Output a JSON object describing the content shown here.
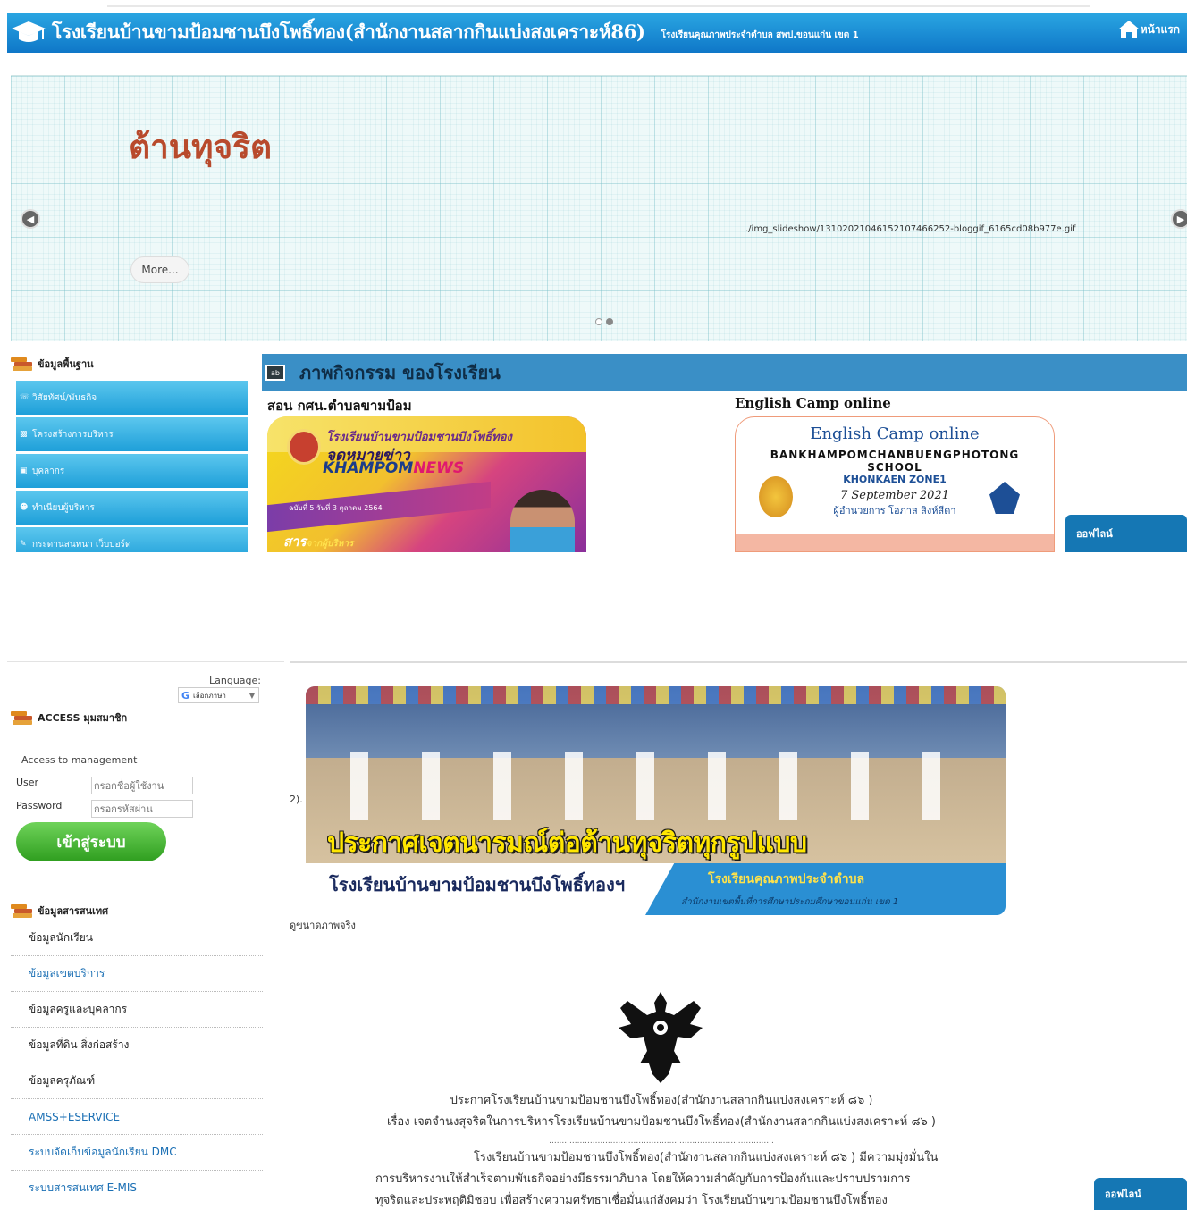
{
  "header": {
    "title": "โรงเรียนบ้านขามป้อมชานบึงโพธิ์ทอง(สำนักงานสลากกินแบ่งสงเคราะห์86)",
    "subtitle": "โรงเรียนคุณภาพประจำตำบล สพป.ขอนแก่น เขต 1",
    "home_label": "หน้าแรก"
  },
  "slideshow": {
    "heading": "ต้านทุจริต",
    "caption": "./img_slideshow/131020210461521074662​52-bloggif_6165cd08b977e.gif",
    "more_label": "More..."
  },
  "basic_info": {
    "heading": "ข้อมูลพื้นฐาน",
    "items": [
      {
        "label": "วิสัยทัศน์/พันธกิจ"
      },
      {
        "label": "โครงสร้างการบริหาร"
      },
      {
        "label": "บุคลากร"
      },
      {
        "label": "ทำเนียบผู้บริหาร"
      },
      {
        "label": "กระดานสนทนา เว็บบอร์ด"
      }
    ]
  },
  "activities": {
    "heading": "ภาพกิจกรรม ของโรงเรียน",
    "cards": [
      {
        "title": "สอน กศน.ตำบลขามป้อม",
        "img_line1": "โรงเรียนบ้านขามป้อมชานบึงโพธิ์ทอง",
        "img_line2": "จดหมายข่าว",
        "img_line3": "KHAMPOM",
        "img_line3b": "NEWS",
        "img_line4": "ฉบับที่ 5 วันที่ 3 ตุลาคม 2564",
        "img_line5": "สาร",
        "img_line5b": "จากผู้บริหาร"
      },
      {
        "title": "English Camp online",
        "img_line1": "English Camp online",
        "img_line2": "BANKHAMPOMCHANBUENGPHOTONG",
        "img_line3": "SCHOOL",
        "img_line4": "KHONKAEN ZONE1",
        "img_line5": "7 September 2021",
        "img_line6": "ผู้อำนวยการ โอภาส สิงห์สีดา"
      }
    ],
    "offline_label": "ออฟไลน์"
  },
  "language": {
    "label": "Language:",
    "selected": "เลือกภาษา"
  },
  "access": {
    "heading": "ACCESS มุมสมาชิก",
    "management_label": "Access to management",
    "user_label": "User",
    "user_placeholder": "กรอกชื่อผู้ใช้งาน",
    "password_label": "Password",
    "password_placeholder": "กรอกรหัสผ่าน",
    "login_label": "เข้าสู่ระบบ"
  },
  "info": {
    "heading": "ข้อมูลสารสนเทศ",
    "items": [
      {
        "label": "ข้อมูลนักเรียน",
        "style": "dark"
      },
      {
        "label": "ข้อมูลเขตบริการ",
        "style": "blue"
      },
      {
        "label": "ข้อมูลครูและบุคลากร",
        "style": "dark"
      },
      {
        "label": "ข้อมูลที่ดิน สิ่งก่อสร้าง",
        "style": "dark"
      },
      {
        "label": "ข้อมูลครุภัณฑ์",
        "style": "dark"
      },
      {
        "label": "AMSS+ESERVICE",
        "style": "blue"
      },
      {
        "label": "ระบบจัดเก็บข้อมูลนักเรียน DMC",
        "style": "blue"
      },
      {
        "label": "ระบบสารสนเทศ E-MIS",
        "style": "blue"
      }
    ]
  },
  "main": {
    "number": "2).",
    "banner_headline": "ประกาศเจตนารมณ์ต่อต้านทุจริตทุกรูปแบบ",
    "banner_school": "โรงเรียนบ้านขามป้อมชานบึงโพธิ์ทองฯ",
    "banner_quality": "โรงเรียนคุณภาพประจำตำบล",
    "banner_office": "สำนักงานเขตพื้นที่การศึกษาประถมศึกษาขอนแก่น เขต 1",
    "fullsize_label": "ดูขนาดภาพจริง",
    "announce_line1": "ประกาศโรงเรียนบ้านขามป้อมชานบึงโพธิ์ทอง(สำนักงานสลากกินแบ่งสงเคราะห์ ๘๖ )",
    "announce_line2": "เรื่อง เจตจำนงสุจริตในการบริหารโรงเรียนบ้านขามป้อมชานบึงโพธิ์ทอง(สำนักงานสลากกินแบ่งสงเคราะห์ ๘๖ )",
    "announce_dots": "........................................................................................",
    "announce_p1": "โรงเรียนบ้านขามป้อมชานบึงโพธิ์ทอง(สำนักงานสลากกินแบ่งสงเคราะห์ ๘๖ ) มีความมุ่งมั่นใน",
    "announce_p2": "การบริหารงานให้สำเร็จตามพันธกิจอย่างมีธรรมาภิบาล โดยให้ความสำคัญกับการป้องกันและปราบปรามการ",
    "announce_p3": "ทุจริตและประพฤติมิชอบ เพื่อสร้างความศรัทธาเชื่อมั่นแก่สังคมว่า โรงเรียนบ้านขามป้อมชานบึงโพธิ์ทอง"
  },
  "colors": {
    "header_blue": "#1b8fd6",
    "menu_blue": "#2fafe3",
    "activity_bar": "#3a8fc6",
    "login_green": "#3fb02c",
    "offline_blue": "#1577b4",
    "slide_heading": "#b84a2c"
  }
}
